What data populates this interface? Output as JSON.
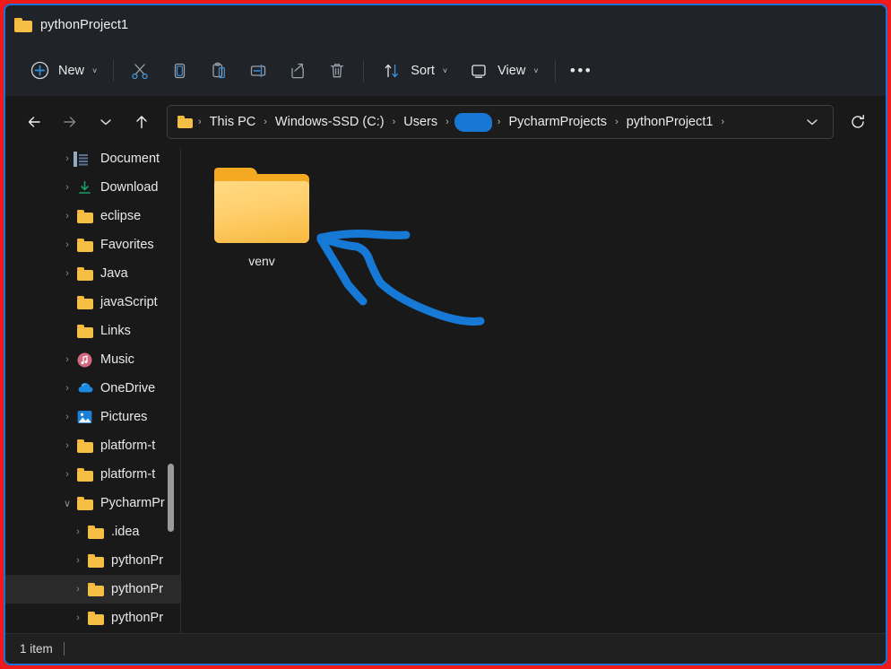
{
  "window": {
    "title": "pythonProject1",
    "folder_icon": "folder-icon",
    "border_accent": "#1d72d8",
    "annotation_border": "#f01a1a"
  },
  "toolbar": {
    "new_label": "New",
    "new_icon": "plus-circle-icon",
    "cut_icon": "scissors-icon",
    "copy_icon": "copy-icon",
    "paste_icon": "paste-icon",
    "rename_icon": "rename-icon",
    "share_icon": "share-icon",
    "delete_icon": "trash-icon",
    "sort_label": "Sort",
    "sort_icon": "sort-arrows-icon",
    "view_label": "View",
    "view_icon": "monitor-icon",
    "more_label": "•••",
    "chevron": "˅"
  },
  "address": {
    "back_icon": "arrow-left-icon",
    "forward_icon": "arrow-right-icon",
    "recent_icon": "chevron-down-icon",
    "up_icon": "arrow-up-icon",
    "dropdown_icon": "chevron-down-icon",
    "refresh_icon": "refresh-icon",
    "separator": "›",
    "crumbs": [
      {
        "label": "This PC",
        "type": "text"
      },
      {
        "label": "Windows-SSD (C:)",
        "type": "text"
      },
      {
        "label": "Users",
        "type": "text"
      },
      {
        "label": "",
        "type": "redacted"
      },
      {
        "label": "PycharmProjects",
        "type": "text"
      },
      {
        "label": "pythonProject1",
        "type": "text"
      }
    ]
  },
  "sidebar": {
    "items": [
      {
        "label": "Document",
        "icon": "document-icon",
        "twisty": "›",
        "level": 0,
        "selected": false
      },
      {
        "label": "Download",
        "icon": "download-icon",
        "twisty": "›",
        "level": 0,
        "selected": false
      },
      {
        "label": "eclipse",
        "icon": "folder-icon",
        "twisty": "›",
        "level": 0,
        "selected": false
      },
      {
        "label": "Favorites",
        "icon": "folder-icon",
        "twisty": "›",
        "level": 0,
        "selected": false
      },
      {
        "label": "Java",
        "icon": "folder-icon",
        "twisty": "›",
        "level": 0,
        "selected": false
      },
      {
        "label": "javaScript",
        "icon": "folder-icon",
        "twisty": "",
        "level": 0,
        "selected": false
      },
      {
        "label": "Links",
        "icon": "folder-icon",
        "twisty": "",
        "level": 0,
        "selected": false
      },
      {
        "label": "Music",
        "icon": "music-icon",
        "twisty": "›",
        "level": 0,
        "selected": false
      },
      {
        "label": "OneDrive",
        "icon": "onedrive-icon",
        "twisty": "›",
        "level": 0,
        "selected": false
      },
      {
        "label": "Pictures",
        "icon": "pictures-icon",
        "twisty": "›",
        "level": 0,
        "selected": false
      },
      {
        "label": "platform-t",
        "icon": "folder-icon",
        "twisty": "›",
        "level": 0,
        "selected": false
      },
      {
        "label": "platform-t",
        "icon": "folder-icon",
        "twisty": "›",
        "level": 0,
        "selected": false
      },
      {
        "label": "PycharmPr",
        "icon": "folder-icon",
        "twisty": "∨",
        "level": 0,
        "selected": false
      },
      {
        "label": ".idea",
        "icon": "folder-icon",
        "twisty": "›",
        "level": 1,
        "selected": false
      },
      {
        "label": "pythonPr",
        "icon": "folder-icon",
        "twisty": "›",
        "level": 1,
        "selected": false
      },
      {
        "label": "pythonPr",
        "icon": "folder-icon",
        "twisty": "›",
        "level": 1,
        "selected": true
      },
      {
        "label": "pythonPr",
        "icon": "folder-icon",
        "twisty": "›",
        "level": 1,
        "selected": false
      }
    ]
  },
  "content": {
    "files": [
      {
        "name": "venv",
        "icon": "folder-icon"
      }
    ],
    "annotation": {
      "type": "hand-drawn-arrow",
      "color": "#1779d6",
      "points_to": "venv"
    }
  },
  "statusbar": {
    "item_count": "1 item"
  }
}
